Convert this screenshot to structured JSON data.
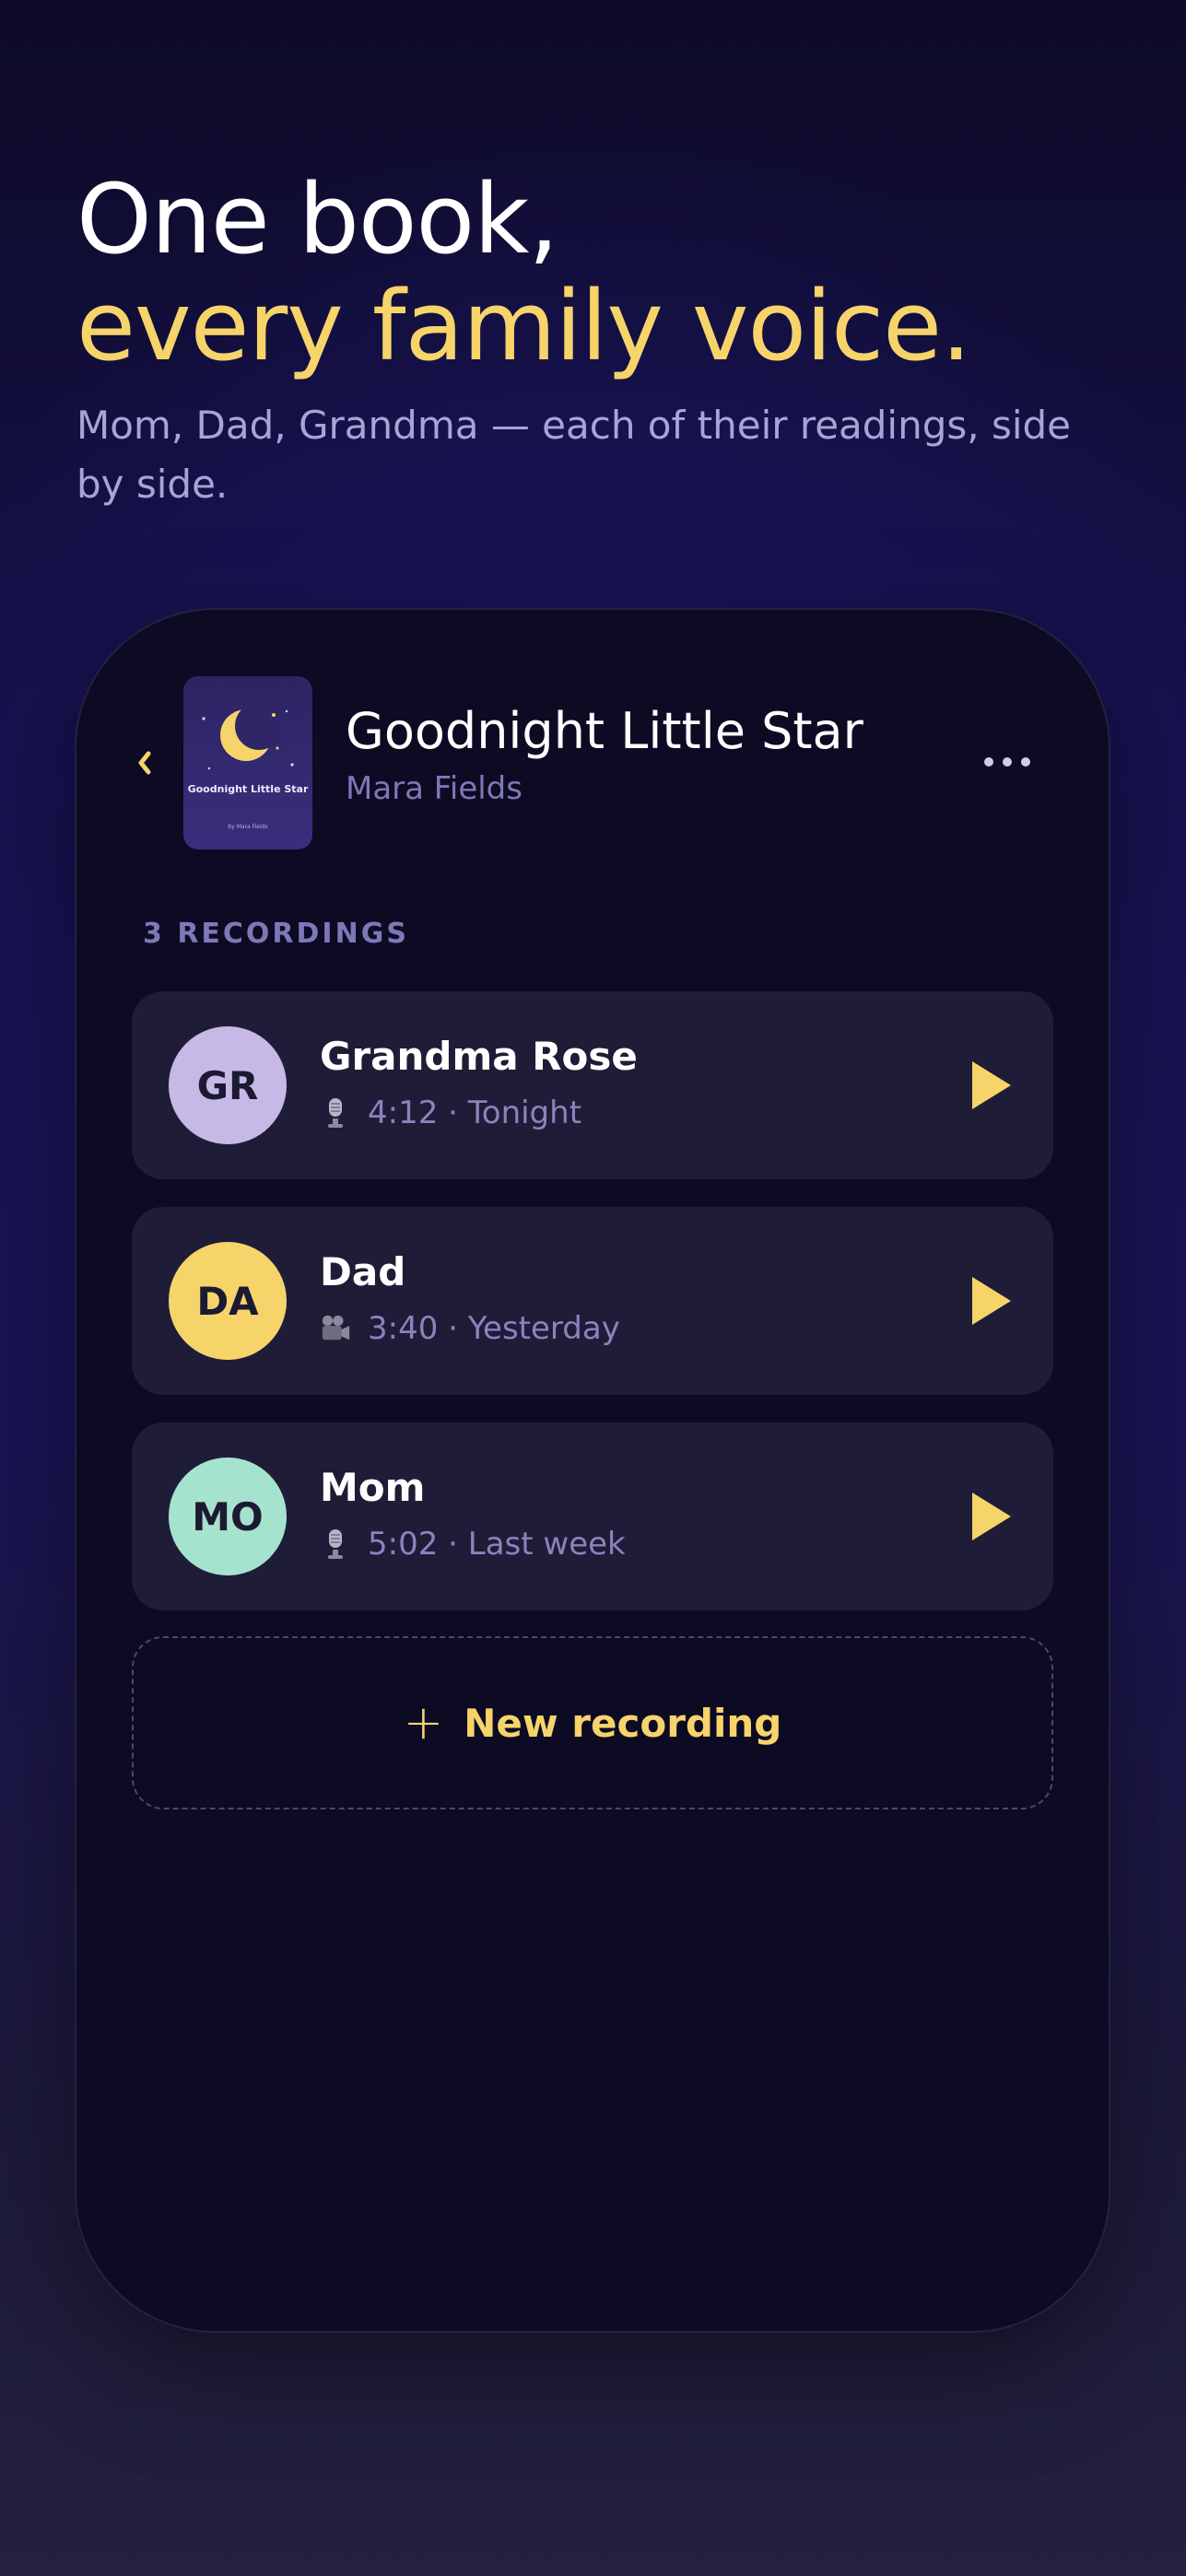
{
  "hero": {
    "line1": "One book,",
    "line2": "every family voice.",
    "subtitle": "Mom, Dad, Grandma — each of their readings, side by side."
  },
  "book": {
    "title": "Goodnight Little Star",
    "author": "Mara Fields",
    "cover_title": "Goodnight Little Star",
    "cover_author": "by Mara Fields"
  },
  "section_label": "3 RECORDINGS",
  "recordings": [
    {
      "initials": "GR",
      "name": "Grandma Rose",
      "icon": "microphone-icon",
      "meta": "4:12 · Tonight",
      "avatar_color": "#c7b9e6"
    },
    {
      "initials": "DA",
      "name": "Dad",
      "icon": "video-camera-icon",
      "meta": "3:40 · Yesterday",
      "avatar_color": "#f6d46a"
    },
    {
      "initials": "MO",
      "name": "Mom",
      "icon": "microphone-icon",
      "meta": "5:02 · Last week",
      "avatar_color": "#a5e3cf"
    }
  ],
  "new_recording": {
    "plus": "+",
    "label": "New recording"
  },
  "colors": {
    "accent": "#f6d46a",
    "card": "#1f1c38",
    "phone_bg": "#0d0a24",
    "muted": "#8a83bd"
  }
}
